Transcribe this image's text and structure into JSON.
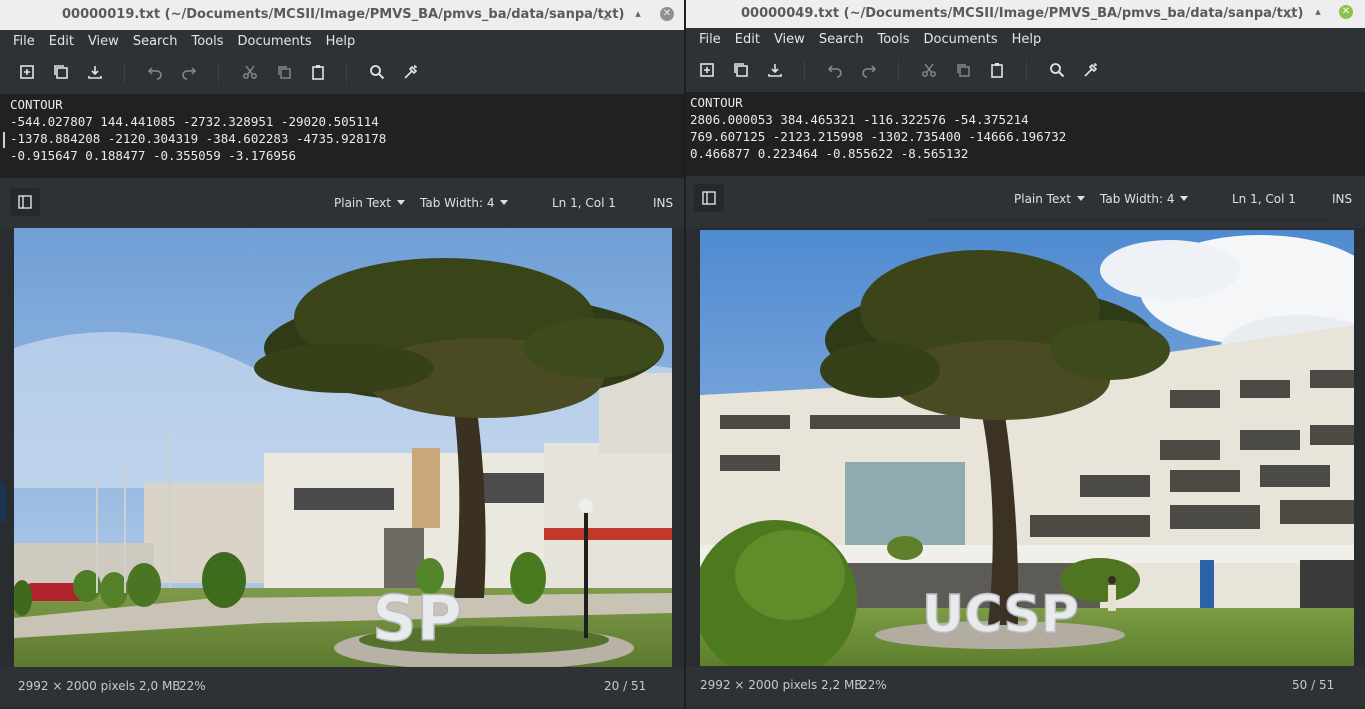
{
  "left_window": {
    "title": "00000019.txt (~/Documents/MCSII/Image/PMVS_BA/pmvs_ba/data/sanpa/txt)",
    "menu": [
      "File",
      "Edit",
      "View",
      "Search",
      "Tools",
      "Documents",
      "Help"
    ],
    "lines": [
      "CONTOUR",
      "-544.027807 144.441085 -2732.328951 -29020.505114",
      "-1378.884208 -2120.304319 -384.602283 -4735.928178",
      "-0.915647 0.188477 -0.355059 -3.176956"
    ],
    "status": {
      "language": "Plain Text",
      "tab_width": "Tab Width:  4",
      "position": "Ln 1, Col 1",
      "mode": "INS"
    }
  },
  "right_window": {
    "title": "00000049.txt (~/Documents/MCSII/Image/PMVS_BA/pmvs_ba/data/sanpa/txt)",
    "menu": [
      "File",
      "Edit",
      "View",
      "Search",
      "Tools",
      "Documents",
      "Help"
    ],
    "lines": [
      "CONTOUR",
      "2806.000053 384.465321 -116.322576 -54.375214",
      "769.607125 -2123.215998 -1302.735400 -14666.196732",
      "0.466877 0.223464 -0.855622 -8.565132"
    ],
    "status": {
      "language": "Plain Text",
      "tab_width": "Tab Width:  4",
      "position": "Ln 1, Col 1",
      "mode": "INS"
    }
  },
  "left_viewer": {
    "image_info": "2992 × 2000 pixels  2,0 MB",
    "zoom": "22%",
    "counter": "20 / 51",
    "sign_text": "SP"
  },
  "right_viewer": {
    "image_info": "2992 × 2000 pixels  2,2 MB",
    "zoom": "22%",
    "counter": "50 / 51",
    "sign_text": "UCSP"
  },
  "icons": [
    "new-document-icon",
    "copy-document-icon",
    "save-icon",
    "undo-icon",
    "redo-icon",
    "cut-icon",
    "copy-icon",
    "paste-icon",
    "search-icon",
    "replace-icon",
    "side-panel-icon",
    "close-icon",
    "minimize-icon",
    "maximize-icon"
  ],
  "colors": {
    "sky": "#8fb6e0",
    "grass": "#6f8a3a",
    "building": "#e8e5dc",
    "editor_bg": "#1f2123",
    "chrome": "#2f3235"
  }
}
